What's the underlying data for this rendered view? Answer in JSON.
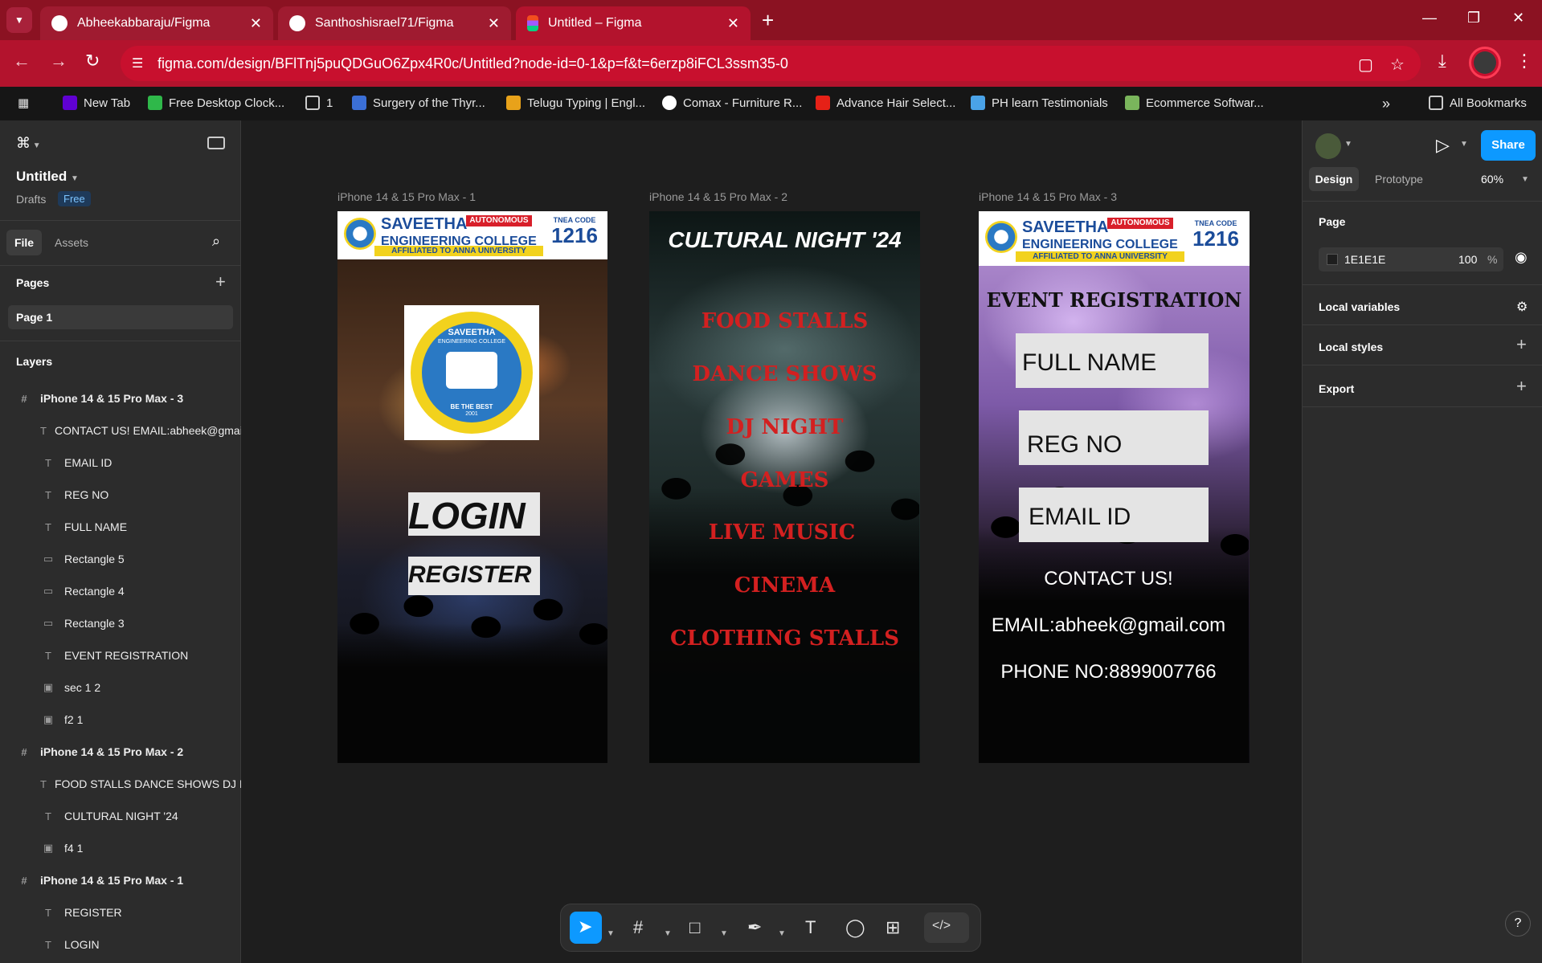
{
  "browser": {
    "tabs": [
      {
        "label": "Abheekabbaraju/Figma",
        "icon_color": "#ffffff"
      },
      {
        "label": "Santhoshisrael71/Figma",
        "icon_color": "#ffffff"
      },
      {
        "label": "Untitled – Figma",
        "icon_color": "#f24e1e"
      }
    ],
    "url": "figma.com/design/BFlTnj5puQDGuO6Zpx4R0c/Untitled?node-id=0-1&p=f&t=6erzp8iFCL3ssm35-0",
    "bookmarks": [
      {
        "label": "New Tab",
        "icon_color": "#6001d2"
      },
      {
        "label": "Free Desktop Clock...",
        "icon_color": "#2fb84a"
      },
      {
        "label": "1",
        "icon_color": "#cccccc"
      },
      {
        "label": "Surgery of the Thyr...",
        "icon_color": "#3b6fd6"
      },
      {
        "label": "Telugu Typing | Engl...",
        "icon_color": "#e8a21a"
      },
      {
        "label": "Comax - Furniture R...",
        "icon_color": "#ffffff"
      },
      {
        "label": "Advance Hair Select...",
        "icon_color": "#e62117"
      },
      {
        "label": "PH learn Testimonials",
        "icon_color": "#4aa3e8"
      },
      {
        "label": "Ecommerce Softwar...",
        "icon_color": "#7ab55c"
      }
    ],
    "all_bookmarks": "All Bookmarks",
    "accent": "#b3132d"
  },
  "figma": {
    "file_name": "Untitled",
    "drafts": "Drafts",
    "plan_badge": "Free",
    "left_tabs": {
      "file": "File",
      "assets": "Assets"
    },
    "pages_header": "Pages",
    "pages": [
      "Page 1"
    ],
    "layers_header": "Layers",
    "layers": [
      {
        "name": "iPhone 14 & 15 Pro Max - 3",
        "kind": "frame"
      },
      {
        "name": "CONTACT US! EMAIL:abheek@gmail.com",
        "kind": "text"
      },
      {
        "name": "EMAIL ID",
        "kind": "text"
      },
      {
        "name": "REG NO",
        "kind": "text"
      },
      {
        "name": "FULL NAME",
        "kind": "text"
      },
      {
        "name": "Rectangle 5",
        "kind": "rect"
      },
      {
        "name": "Rectangle 4",
        "kind": "rect"
      },
      {
        "name": "Rectangle 3",
        "kind": "rect"
      },
      {
        "name": "EVENT REGISTRATION",
        "kind": "text"
      },
      {
        "name": "sec 1 2",
        "kind": "image"
      },
      {
        "name": "f2 1",
        "kind": "image"
      },
      {
        "name": "iPhone 14 & 15 Pro Max - 2",
        "kind": "frame"
      },
      {
        "name": "FOOD STALLS DANCE SHOWS DJ NIGHT",
        "kind": "text"
      },
      {
        "name": "CULTURAL NIGHT '24",
        "kind": "text"
      },
      {
        "name": "f4 1",
        "kind": "image"
      },
      {
        "name": "iPhone 14 & 15 Pro Max - 1",
        "kind": "frame"
      },
      {
        "name": "REGISTER",
        "kind": "text"
      },
      {
        "name": "LOGIN",
        "kind": "text"
      }
    ],
    "right": {
      "tabs": {
        "design": "Design",
        "prototype": "Prototype"
      },
      "zoom": "60%",
      "share": "Share",
      "page_section": "Page",
      "page_color": "1E1E1E",
      "page_opacity": "100",
      "percent": "%",
      "local_variables": "Local variables",
      "local_styles": "Local styles",
      "export": "Export"
    },
    "help": "?"
  },
  "canvas": {
    "frame1": {
      "label": "iPhone 14 & 15 Pro Max - 1",
      "login": "LOGIN",
      "register": "REGISTER"
    },
    "frame2": {
      "label": "iPhone 14 & 15 Pro Max - 2",
      "title": "CULTURAL NIGHT '24",
      "items": [
        "FOOD STALLS",
        "DANCE SHOWS",
        "DJ NIGHT",
        "GAMES",
        "LIVE MUSIC",
        "CINEMA",
        "CLOTHING STALLS"
      ]
    },
    "frame3": {
      "label": "iPhone 14 & 15 Pro Max - 3",
      "title": "EVENT REGISTRATION",
      "fields": [
        "FULL NAME",
        "REG NO",
        "EMAIL ID"
      ],
      "contact": "CONTACT US!",
      "email": "EMAIL:abheek@gmail.com",
      "phone": "PHONE NO:8899007766"
    },
    "college": {
      "name_line1": "SAVEETHA",
      "name_line2": "ENGINEERING COLLEGE",
      "autonomous": "AUTONOMOUS",
      "affiliated": "AFFILIATED TO ANNA UNIVERSITY",
      "code_label": "TNEA CODE",
      "code": "1216",
      "seal_top": "SAVEETHA",
      "seal_sub": "ENGINEERING COLLEGE",
      "seal_motto": "BE THE BEST",
      "seal_year": "2001"
    }
  }
}
